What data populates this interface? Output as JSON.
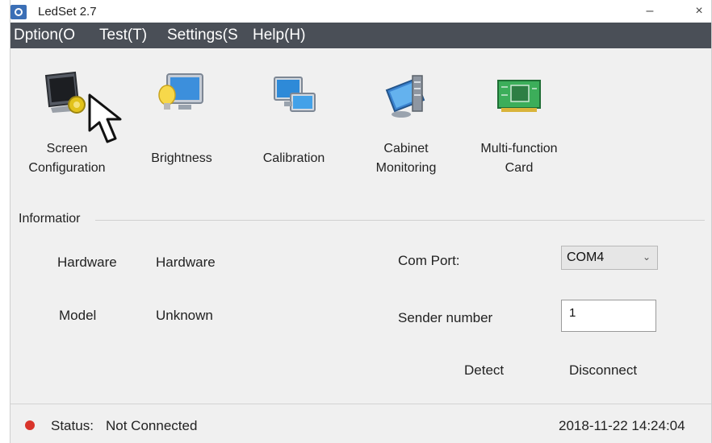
{
  "window": {
    "title": "LedSet 2.7",
    "minimize_glyph": "–",
    "close_glyph": "×"
  },
  "menu": [
    "Dption(O",
    "Test(T)",
    "Settings(S",
    "Help(H)"
  ],
  "toolbar": [
    {
      "label_line1": "Screen",
      "label_line2": "Configuration",
      "icon": "monitor-gear-icon"
    },
    {
      "label_line1": "Brightness",
      "label_line2": "",
      "icon": "brightness-monitor-icon"
    },
    {
      "label_line1": "Calibration",
      "label_line2": "",
      "icon": "calibration-monitors-icon"
    },
    {
      "label_line1": "Cabinet",
      "label_line2": "Monitoring",
      "icon": "monitoring-icon"
    },
    {
      "label_line1": "Multi-function",
      "label_line2": "Card",
      "icon": "circuit-card-icon"
    }
  ],
  "info": {
    "group_label": "Informatior",
    "hardware_label": "Hardware",
    "hardware_value": "Hardware",
    "model_label": "Model",
    "model_value": "Unknown",
    "com_port_label": "Com Port:",
    "com_port_value": "COM4",
    "sender_label": "Sender number",
    "sender_value": "1",
    "detect_label": "Detect",
    "disconnect_label": "Disconnect"
  },
  "status": {
    "label": "Status:",
    "value": "Not Connected",
    "datetime": "2018-11-22 14:24:04",
    "indicator_color": "#d9342b"
  },
  "colors": {
    "menubar": "#4a4f57",
    "window_bg": "#f0f0f0"
  }
}
